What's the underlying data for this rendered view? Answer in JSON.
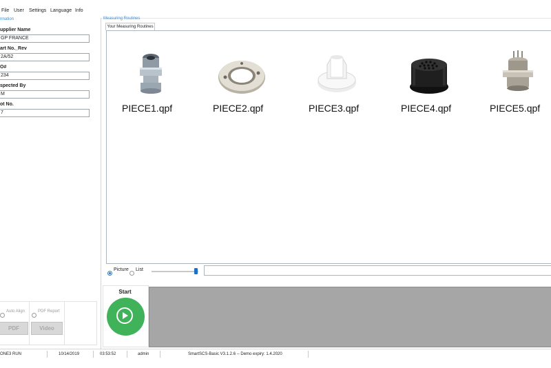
{
  "menu": [
    "File",
    "User",
    "Settings",
    "Language",
    "Info"
  ],
  "info_panel": {
    "caption": "rmation",
    "fields": [
      {
        "label": "upplier Name",
        "value": "GP FRANCE"
      },
      {
        "label": "art No._Rev",
        "value": "2A/52"
      },
      {
        "label": "O#",
        "value": "234"
      },
      {
        "label": "spected By",
        "value": "M"
      },
      {
        "label": "ot No.",
        "value": "7"
      }
    ]
  },
  "options": {
    "auto_align_label": "Auto Align",
    "pdf_report_label": "PDF Report",
    "pdf_button": "PDF",
    "video_button": "Video"
  },
  "routines": {
    "caption": "Measuring Routines",
    "tab_label": "Your Measuring Routines",
    "pieces": [
      "PIECE1.qpf",
      "PIECE2.qpf",
      "PIECE3.qpf",
      "PIECE4.qpf",
      "PIECE5.qpf"
    ]
  },
  "view": {
    "picture_label": "Picture",
    "list_label": "List",
    "selected": "Picture"
  },
  "start": {
    "label": "Start"
  },
  "status": {
    "items": [
      "ONE3 RUN",
      "10/14/2019",
      "03:53:52",
      "admin",
      "SmartSCS-Basic V3.1.2.6  -- Demo expiry: 1.4.2020"
    ]
  },
  "colors": {
    "accent": "#3a8dd8",
    "start_green": "#3fb25a",
    "video_gray": "#a6a6a6"
  }
}
